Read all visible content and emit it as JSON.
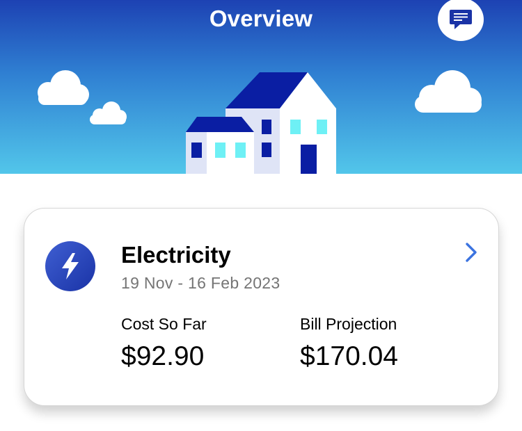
{
  "header": {
    "title": "Overview",
    "chat_icon": "chat-bubble-icon"
  },
  "colors": {
    "sky_top": "#1d42b3",
    "sky_bottom": "#52c6ea",
    "accent": "#1a33a6",
    "chevron": "#3b73e0"
  },
  "card": {
    "icon": "lightning-bolt-icon",
    "title": "Electricity",
    "date_range": "19 Nov - 16 Feb 2023",
    "stats": [
      {
        "label": "Cost So Far",
        "value": "$92.90"
      },
      {
        "label": "Bill Projection",
        "value": "$170.04"
      }
    ],
    "nav_icon": "chevron-right-icon"
  }
}
